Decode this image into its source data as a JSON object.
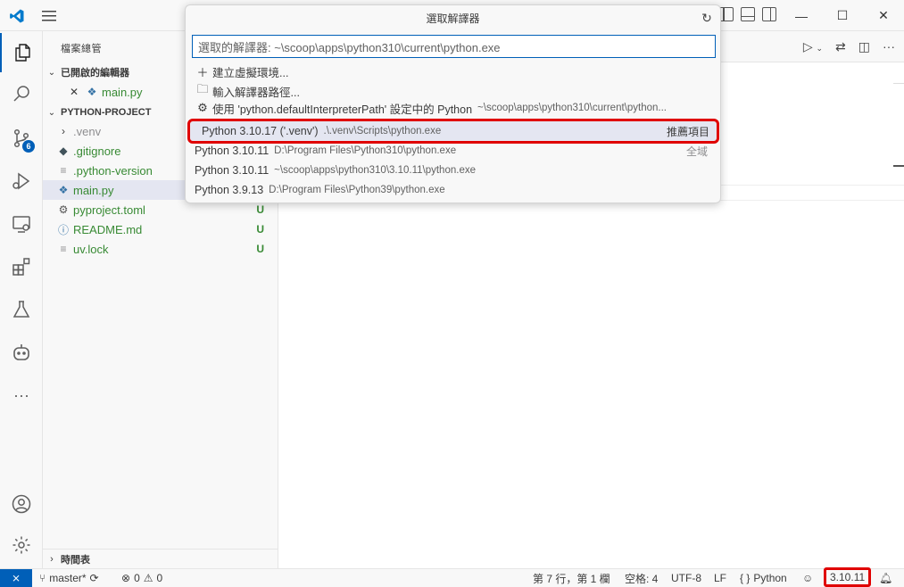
{
  "quick_pick": {
    "title": "選取解譯器",
    "input_value": "選取的解譯器: ~\\scoop\\apps\\python310\\current\\python.exe",
    "actions": [
      {
        "icon": "plus-icon",
        "label": "建立虛擬環境..."
      },
      {
        "icon": "folder-icon",
        "label": "輸入解譯器路徑..."
      },
      {
        "icon": "gear-icon",
        "label": "使用 'python.defaultInterpreterPath' 設定中的 Python",
        "desc": "~\\scoop\\apps\\python310\\current\\python..."
      }
    ],
    "interpreters": [
      {
        "label": "Python 3.10.17 ('.venv')",
        "path": ".\\.venv\\Scripts\\python.exe",
        "tag": "推薦項目"
      },
      {
        "label": "Python 3.10.11",
        "path": "D:\\Program Files\\Python310\\python.exe",
        "tag": "全域"
      },
      {
        "label": "Python 3.10.11",
        "path": "~\\scoop\\apps\\python310\\3.10.11\\python.exe",
        "tag": ""
      },
      {
        "label": "Python 3.9.13",
        "path": "D:\\Program Files\\Python39\\python.exe",
        "tag": ""
      }
    ]
  },
  "sidebar": {
    "title": "檔案總管",
    "open_editors_label": "已開啟的編輯器",
    "open_editors": [
      {
        "name": "main.py"
      }
    ],
    "project_label": "PYTHON-PROJECT",
    "files": [
      {
        "name": ".venv",
        "icon": "chevron-right-icon",
        "status": ""
      },
      {
        "name": ".gitignore",
        "icon": "git-icon",
        "status": ""
      },
      {
        "name": ".python-version",
        "icon": "file-lines-icon",
        "status": ""
      },
      {
        "name": "main.py",
        "icon": "python-icon",
        "status": ""
      },
      {
        "name": "pyproject.toml",
        "icon": "gear-icon",
        "status": "U"
      },
      {
        "name": "README.md",
        "icon": "info-icon",
        "status": "U"
      },
      {
        "name": "uv.lock",
        "icon": "file-lines-icon",
        "status": "U"
      }
    ],
    "outline_label": "時間表"
  },
  "activity": {
    "source_control_badge": "6"
  },
  "statusbar": {
    "branch": "master*",
    "errors": "0",
    "warnings": "0",
    "position": "第 7 行，第 1 欄",
    "spaces": "空格: 4",
    "encoding": "UTF-8",
    "eol": "LF",
    "language": "Python",
    "python_version": "3.10.11"
  },
  "colors": {
    "accent": "#005fb8",
    "highlight_border": "#e00000",
    "untracked": "#388a34"
  }
}
